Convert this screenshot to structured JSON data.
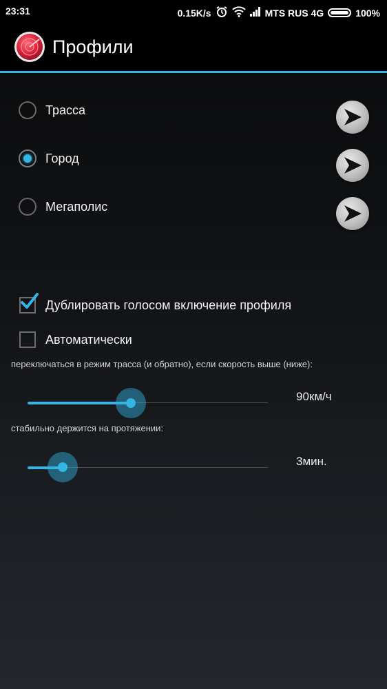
{
  "status_bar": {
    "time": "23:31",
    "speed": "0.15K/s",
    "carrier": "MTS RUS 4G",
    "battery": "100%"
  },
  "action_bar": {
    "title": "Профили",
    "icon": "radar-icon"
  },
  "profiles": [
    {
      "label": "Трасса",
      "selected": false
    },
    {
      "label": "Город",
      "selected": true
    },
    {
      "label": "Мегаполис",
      "selected": false
    }
  ],
  "options": {
    "voice_duplicate": {
      "label": "Дублировать голосом включение профиля",
      "checked": true
    },
    "automatic": {
      "label": "Автоматически",
      "checked": false
    }
  },
  "speed_setting": {
    "hint": "переключаться в режим трасса (и обратно), если скорость выше (ниже):",
    "value_label": "90км/ч",
    "fraction": 0.43
  },
  "duration_setting": {
    "hint": "стабильно держится на протяжении:",
    "value_label": "3мин.",
    "fraction": 0.145
  },
  "colors": {
    "accent": "#33b5e5",
    "background": "#121417"
  }
}
